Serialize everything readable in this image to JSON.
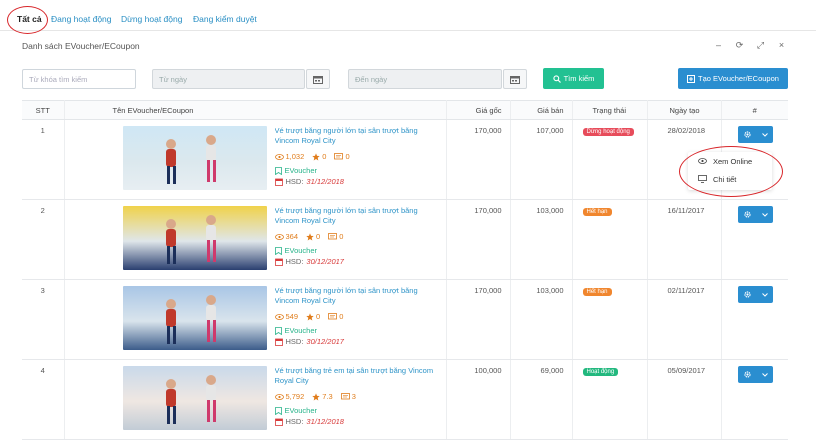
{
  "tabs": [
    {
      "label": "Tất cả"
    },
    {
      "label": "Đang hoạt động"
    },
    {
      "label": "Dừng hoạt động"
    },
    {
      "label": "Đang kiểm duyệt"
    }
  ],
  "panel": {
    "title": "Danh sách EVoucher/ECoupon"
  },
  "filters": {
    "keyword_placeholder": "Từ khóa tìm kiếm",
    "from_placeholder": "Từ ngày",
    "to_placeholder": "Đến ngày",
    "search_label": "Tìm kiếm",
    "create_label": "Tạo EVoucher/ECoupon"
  },
  "table": {
    "headers": [
      "STT",
      "Tên EVoucher/ECoupon",
      "Giá gốc",
      "Giá bán",
      "Trạng thái",
      "Ngày tạo",
      "#"
    ],
    "rows": [
      {
        "stt": "1",
        "name": "Vé trượt băng người lớn tại sân trượt băng Vincom Royal City",
        "views": "1,032",
        "rating": "0",
        "comments": "0",
        "type": "EVoucher",
        "hsd_label": "HSD:",
        "hsd": "31/12/2018",
        "price": "170,000",
        "sale": "107,000",
        "status": "Dừng hoạt động",
        "status_color": "#e74c5b",
        "created": "28/02/2018"
      },
      {
        "stt": "2",
        "name": "Vé trượt băng người lớn tại sân trượt băng Vincom Royal City",
        "views": "364",
        "rating": "0",
        "comments": "0",
        "type": "EVoucher",
        "hsd_label": "HSD:",
        "hsd": "30/12/2017",
        "price": "170,000",
        "sale": "103,000",
        "status": "Hết hạn",
        "status_color": "#f0862e",
        "created": "16/11/2017"
      },
      {
        "stt": "3",
        "name": "Vé trượt băng người lớn tại sân trượt băng Vincom Royal City",
        "views": "549",
        "rating": "0",
        "comments": "0",
        "type": "EVoucher",
        "hsd_label": "HSD:",
        "hsd": "30/12/2017",
        "price": "170,000",
        "sale": "103,000",
        "status": "Hết hạn",
        "status_color": "#f0862e",
        "created": "02/11/2017"
      },
      {
        "stt": "4",
        "name": "Vé trượt băng trẻ em tại sân trượt băng Vincom Royal City",
        "views": "5,792",
        "rating": "7.3",
        "comments": "3",
        "type": "EVoucher",
        "hsd_label": "HSD:",
        "hsd": "31/12/2018",
        "price": "100,000",
        "sale": "69,000",
        "status": "Hoạt động",
        "status_color": "#22b87e",
        "created": "05/09/2017"
      }
    ]
  },
  "dropdown": {
    "view_online": "Xem Online",
    "detail": "Chi tiết"
  },
  "icons": {
    "eye": "eye-icon",
    "star": "star-icon",
    "comment": "comment-icon",
    "bookmark": "bookmark-icon",
    "calendar": "calendar-icon",
    "gear": "gear-icon"
  },
  "colors": {
    "accent": "#2a8ed0",
    "green": "#22c192",
    "link": "#2f94c8",
    "highlight_circle": "#d8262a"
  }
}
